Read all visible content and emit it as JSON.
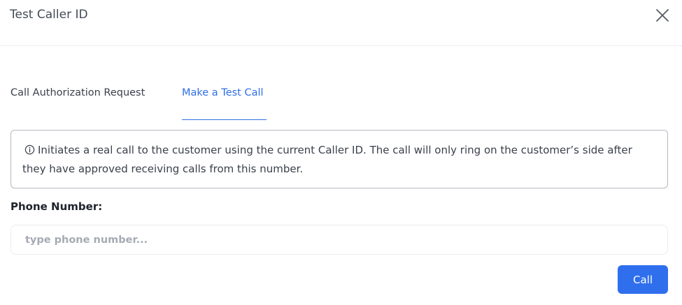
{
  "modal": {
    "title": "Test Caller ID"
  },
  "tabs": [
    {
      "label": "Call Authorization Request",
      "active": false
    },
    {
      "label": "Make a Test Call",
      "active": true
    }
  ],
  "info": {
    "icon": "info-circle-icon",
    "text": "Initiates a real call to the customer using the current Caller ID. The call will only ring on the customer’s side after they have approved receiving calls from this number."
  },
  "phone": {
    "label": "Phone Number:",
    "value": "",
    "placeholder": "type phone number..."
  },
  "actions": {
    "call_label": "Call"
  },
  "colors": {
    "accent": "#2f6fee",
    "active_tab": "#2f6fe4",
    "border": "#b5b8bf"
  }
}
